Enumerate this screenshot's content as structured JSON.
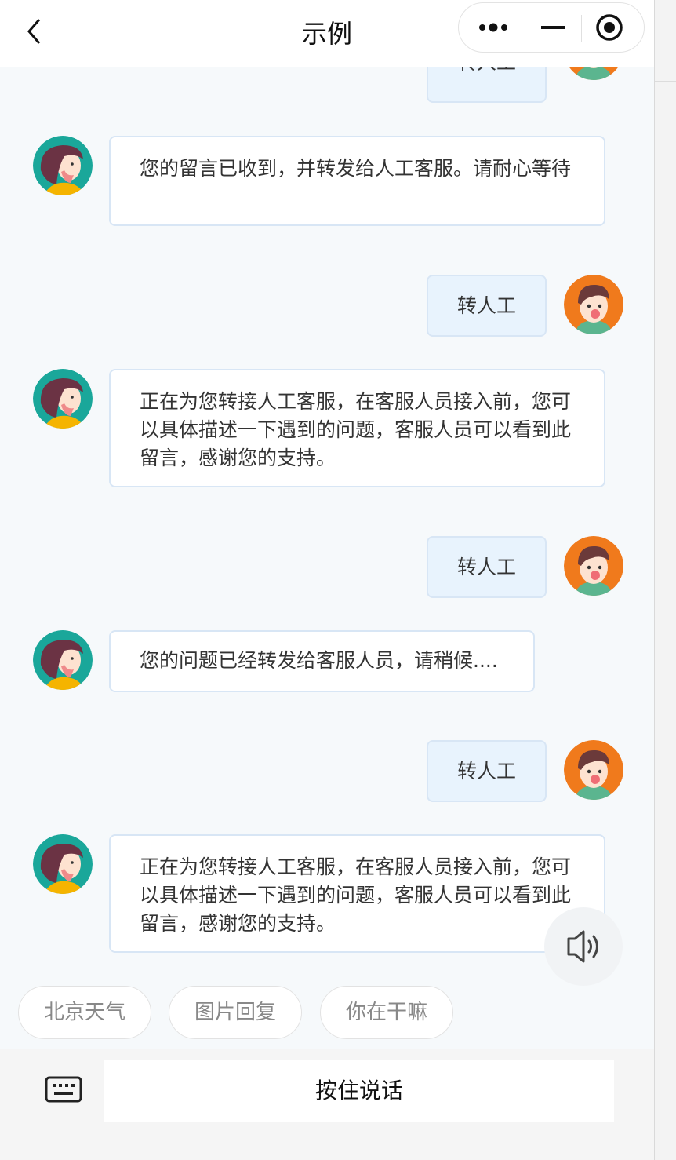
{
  "nav": {
    "title": "示例",
    "back_icon": "chevron-left-icon",
    "more_icon": "more-dots-icon",
    "minimize_icon": "minimize-icon",
    "close_icon": "target-circle-icon"
  },
  "messages": [
    {
      "role": "user",
      "text": "转人工"
    },
    {
      "role": "bot",
      "text": "您的留言已收到，并转发给人工客服。请耐心等待"
    },
    {
      "role": "user",
      "text": "转人工"
    },
    {
      "role": "bot",
      "text": "正在为您转接人工客服，在客服人员接入前，您可以具体描述一下遇到的问题，客服人员可以看到此留言，感谢您的支持。"
    },
    {
      "role": "user",
      "text": "转人工"
    },
    {
      "role": "bot",
      "text": "您的问题已经转发给客服人员，请稍候...."
    },
    {
      "role": "user",
      "text": "转人工"
    },
    {
      "role": "bot",
      "text": "正在为您转接人工客服，在客服人员接入前，您可以具体描述一下遇到的问题，客服人员可以看到此留言，感谢您的支持。"
    }
  ],
  "speaker_icon": "speaker-icon",
  "quick_replies": [
    "北京天气",
    "图片回复",
    "你在干嘛"
  ],
  "input": {
    "keyboard_icon": "keyboard-icon",
    "hold_to_talk": "按住说话"
  },
  "colors": {
    "user_bubble": "#e8f3fd",
    "bot_bubble": "#ffffff",
    "bubble_border": "#d8e6f5",
    "page_bg": "#f6f9fb"
  }
}
